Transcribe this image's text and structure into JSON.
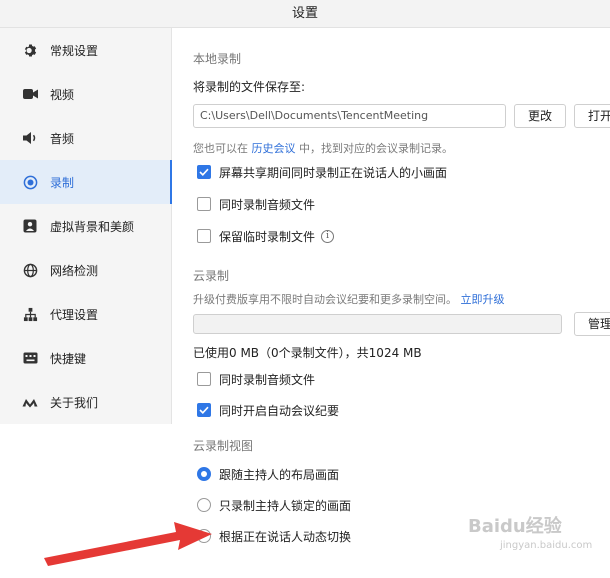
{
  "window": {
    "title": "设置"
  },
  "sidebar": {
    "items": [
      {
        "label": "常规设置",
        "icon": "gear-icon"
      },
      {
        "label": "视频",
        "icon": "video-camera-icon"
      },
      {
        "label": "音频",
        "icon": "speaker-icon"
      },
      {
        "label": "录制",
        "icon": "record-icon",
        "active": true
      },
      {
        "label": "虚拟背景和美颜",
        "icon": "portrait-icon"
      },
      {
        "label": "网络检测",
        "icon": "globe-icon"
      },
      {
        "label": "代理设置",
        "icon": "network-tree-icon"
      },
      {
        "label": "快捷键",
        "icon": "keyboard-icon"
      },
      {
        "label": "关于我们",
        "icon": "logo-icon"
      }
    ],
    "accent_color": "#2f77e6"
  },
  "local": {
    "section_title": "本地录制",
    "save_label": "将录制的文件保存至:",
    "path_value": "C:\\Users\\Dell\\Documents\\TencentMeeting",
    "change_button": "更改",
    "open_button": "打开",
    "hint_prefix": "您也可以在",
    "hint_link": "历史会议",
    "hint_suffix": "中，找到对应的会议录制记录。",
    "options": [
      {
        "label": "屏幕共享期间同时录制正在说话人的小画面",
        "checked": true
      },
      {
        "label": "同时录制音频文件",
        "checked": false
      },
      {
        "label": "保留临时录制文件",
        "checked": false,
        "info": "i"
      }
    ]
  },
  "cloud": {
    "section_title": "云录制",
    "upgrade_hint": "升级付费版享用不限时自动会议纪要和更多录制空间。",
    "upgrade_link": "立即升级",
    "manage_button": "管理",
    "usage_text": "已使用0 MB（0个录制文件），共1024 MB",
    "options": [
      {
        "label": "同时录制音频文件",
        "checked": false
      },
      {
        "label": "同时开启自动会议纪要",
        "checked": true
      }
    ]
  },
  "cloud_view": {
    "section_title": "云录制视图",
    "options": [
      {
        "label": "跟随主持人的布局画面",
        "selected": true
      },
      {
        "label": "只录制主持人锁定的画面",
        "selected": false
      },
      {
        "label": "根据正在说话人动态切换",
        "selected": false
      }
    ]
  },
  "annotation": {
    "color": "#e53935"
  },
  "watermark": {
    "text": "Baidu经验",
    "sub": "jingyan.baidu.com"
  }
}
